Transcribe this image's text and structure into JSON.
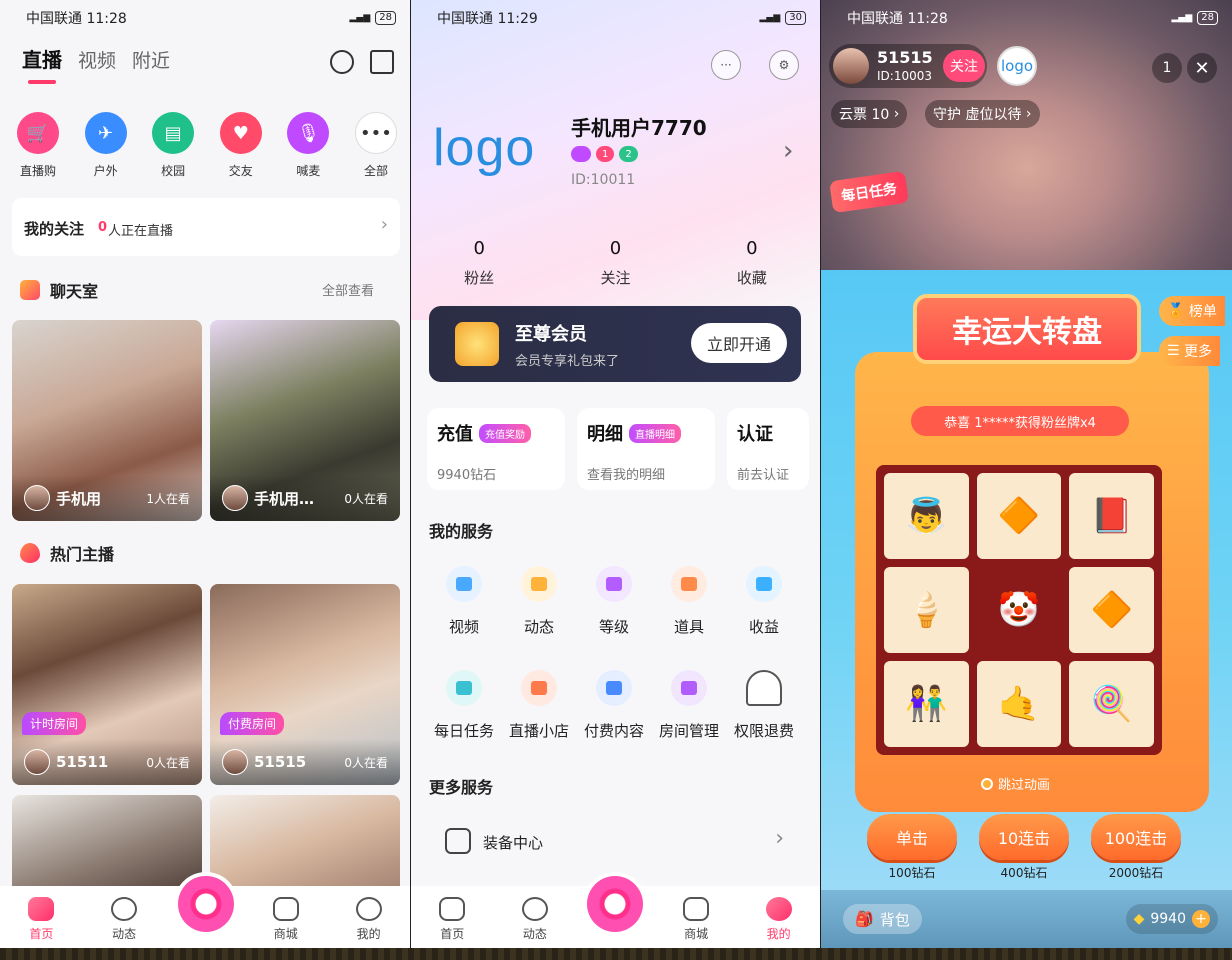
{
  "page1": {
    "status": {
      "carrier": "中国联通 11:28",
      "battery": "28"
    },
    "tabs": [
      "直播",
      "视频",
      "附近"
    ],
    "categories": [
      {
        "label": "直播购",
        "icon": "cart-icon",
        "color": "#ff4a8a"
      },
      {
        "label": "户外",
        "icon": "plane-icon",
        "color": "#3a8dff"
      },
      {
        "label": "校园",
        "icon": "book-icon",
        "color": "#20c08a"
      },
      {
        "label": "交友",
        "icon": "heart-icon",
        "color": "#ff4a6a"
      },
      {
        "label": "喊麦",
        "icon": "mic-icon",
        "color": "#c04aff"
      },
      {
        "label": "全部",
        "icon": "more-icon",
        "color": "#333333"
      }
    ],
    "follow": {
      "label": "我的关注",
      "count": "0",
      "text": "人正在直播"
    },
    "chatroom": {
      "title": "聊天室",
      "viewall": "全部查看"
    },
    "chat_cards": [
      {
        "name": "手机用",
        "watch": "1人在看"
      },
      {
        "name": "手机用…",
        "watch": "0人在看"
      }
    ],
    "hot": {
      "title": "热门主播"
    },
    "hot_cards": [
      {
        "tag": "计时房间",
        "name": "51511",
        "watch": "0人在看"
      },
      {
        "tag": "付费房间",
        "name": "51515",
        "watch": "0人在看"
      }
    ],
    "nav": [
      "首页",
      "动态",
      "商城",
      "我的"
    ]
  },
  "page2": {
    "status": {
      "carrier": "中国联通 11:29",
      "battery": "30"
    },
    "logo": "logo",
    "username": "手机用户7770",
    "badges": [
      "1",
      "2"
    ],
    "uid": "ID:10011",
    "stats": [
      {
        "n": "0",
        "l": "粉丝"
      },
      {
        "n": "0",
        "l": "关注"
      },
      {
        "n": "0",
        "l": "收藏"
      }
    ],
    "vip": {
      "title": "至尊会员",
      "sub": "会员专享礼包来了",
      "btn": "立即开通"
    },
    "cards": [
      {
        "t": "充值",
        "tag": "充值奖励",
        "s": "9940钻石"
      },
      {
        "t": "明细",
        "tag": "直播明细",
        "s": "查看我的明细"
      },
      {
        "t": "认证",
        "tag": "",
        "s": "前去认证"
      }
    ],
    "my_services_title": "我的服务",
    "services": [
      {
        "l": "视频",
        "c": "#4aa8ff"
      },
      {
        "l": "动态",
        "c": "#ffb23a"
      },
      {
        "l": "等级",
        "c": "#b35cff"
      },
      {
        "l": "道具",
        "c": "#ff8a4a"
      },
      {
        "l": "收益",
        "c": "#3ab0ff"
      },
      {
        "l": "每日任务",
        "c": "#3ac0d0"
      },
      {
        "l": "直播小店",
        "c": "#ff7a4a"
      },
      {
        "l": "付费内容",
        "c": "#4a8aff"
      },
      {
        "l": "房间管理",
        "c": "#b05cff"
      },
      {
        "l": "权限退费",
        "c": "#666666"
      }
    ],
    "more_services_title": "更多服务",
    "equip": "装备中心",
    "nav": [
      "首页",
      "动态",
      "商城",
      "我的"
    ]
  },
  "page3": {
    "status": {
      "carrier": "中国联通 11:28",
      "battery": "28"
    },
    "host": {
      "name": "51515",
      "id": "ID:10003",
      "follow": "关注",
      "logo": "logo"
    },
    "viewers": "1",
    "ticket": "云票 10",
    "guard": "守护 虚位以待",
    "daily": "每日任务",
    "title": "幸运大转盘",
    "rank": "榜单",
    "more": "更多",
    "notice": "恭喜 1*****获得粉丝牌x4",
    "prizes": [
      "👼",
      "🔶",
      "📕",
      "🍦",
      "🤡",
      "🔶",
      "👫",
      "🤙",
      "🍭"
    ],
    "skip": "跳过动画",
    "buttons": [
      {
        "l": "单击",
        "c": "100钻石"
      },
      {
        "l": "10连击",
        "c": "400钻石"
      },
      {
        "l": "100连击",
        "c": "2000钻石"
      }
    ],
    "bag": "背包",
    "diamonds": "9940"
  }
}
